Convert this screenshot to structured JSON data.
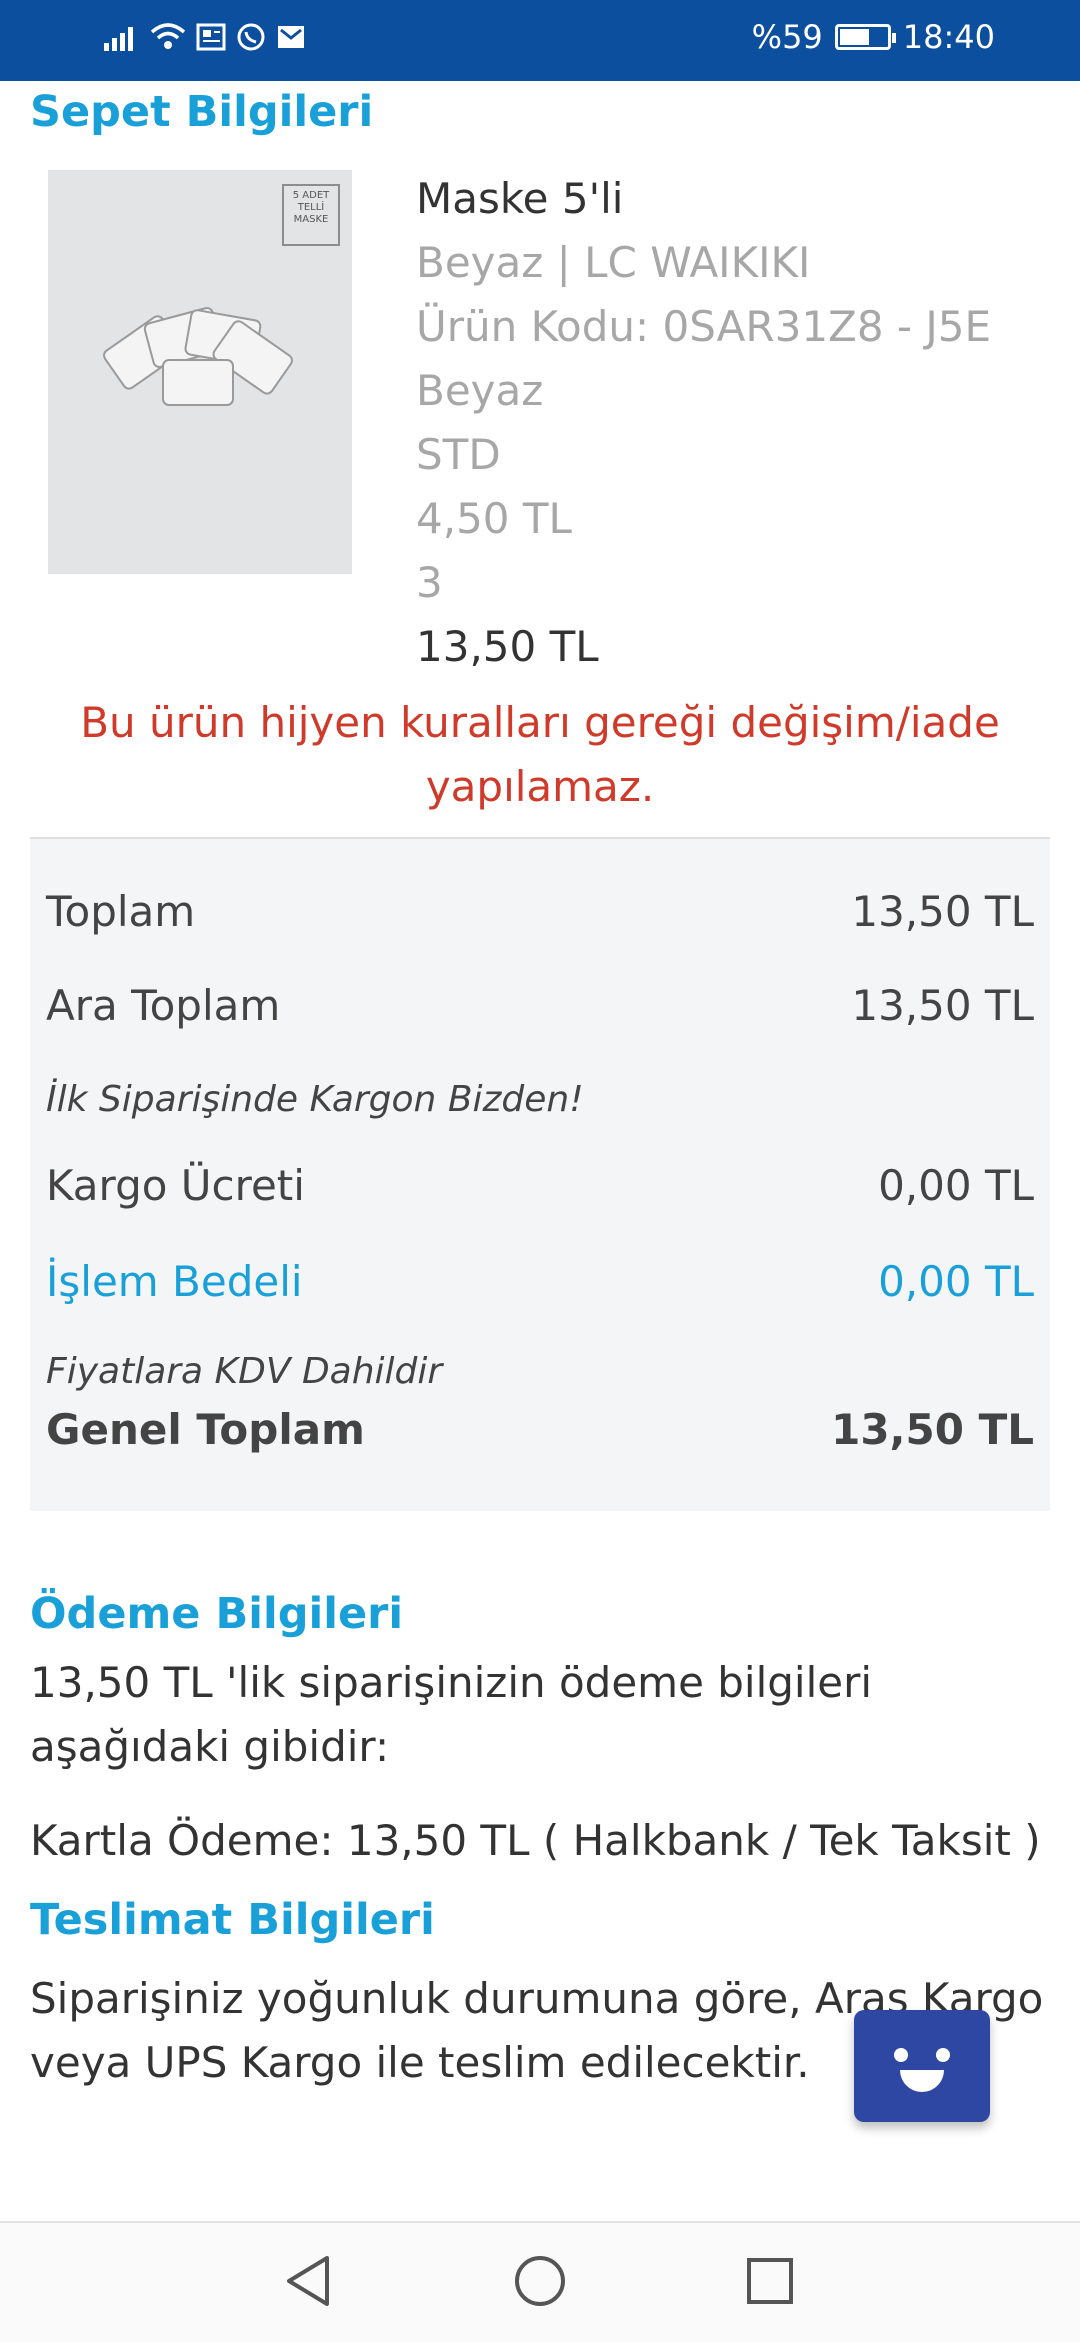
{
  "status_bar": {
    "battery_text": "%59",
    "time": "18:40",
    "battery_level": 0.59
  },
  "cart": {
    "title": "Sepet Bilgileri",
    "product": {
      "name": "Maske 5'li",
      "brand_line": "Beyaz | LC WAIKIKI",
      "code_line": "Ürün Kodu: 0SAR31Z8 - J5E",
      "color": "Beyaz",
      "size": "STD",
      "unit_price": "4,50 TL",
      "quantity": "3",
      "total": "13,50 TL",
      "box_label": "5 ADET TELLİ MASKE"
    },
    "warning": "Bu ürün hijyen kuralları gereği değişim/iade yapılamaz."
  },
  "summary": {
    "toplam_label": "Toplam",
    "toplam_value": "13,50 TL",
    "ara_toplam_label": "Ara Toplam",
    "ara_toplam_value": "13,50 TL",
    "promo_note": "İlk Siparişinde Kargon Bizden!",
    "kargo_label": "Kargo Ücreti",
    "kargo_value": "0,00 TL",
    "islem_label": "İşlem Bedeli",
    "islem_value": "0,00 TL",
    "kdv_note": "Fiyatlara KDV Dahildir",
    "genel_label": "Genel Toplam",
    "genel_value": "13,50 TL"
  },
  "payment": {
    "title": "Ödeme Bilgileri",
    "description": "13,50 TL 'lik siparişinizin ödeme bilgileri aşağıdaki gibidir:",
    "method": "Kartla Ödeme: 13,50 TL ( Halkbank / Tek Taksit )"
  },
  "delivery": {
    "title": "Teslimat Bilgileri",
    "description": "Siparişiniz yoğunluk durumuna göre, Aras Kargo veya UPS Kargo ile teslim edilecektir."
  },
  "icons": {
    "chat": "chat-bot-icon",
    "nav_back": "back-triangle-icon",
    "nav_home": "home-circle-icon",
    "nav_recent": "recent-square-icon"
  },
  "colors": {
    "status_bar": "#0d4f9f",
    "section_title": "#1aa0d8",
    "warning": "#d03a2a",
    "chat_button": "#2e47a3"
  }
}
